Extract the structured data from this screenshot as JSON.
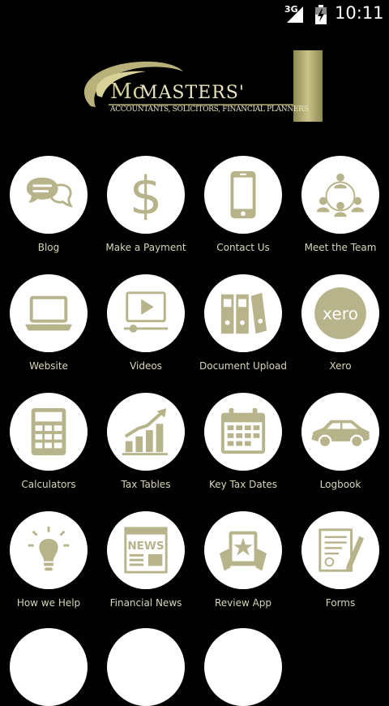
{
  "status_bar": {
    "network": "3G",
    "time": "10:11"
  },
  "logo": {
    "brand_first": "Mc",
    "brand_second": "Masters'",
    "tagline": "ACCOUNTANTS, SOLICITORS, FINANCIAL PLANNERS"
  },
  "colors": {
    "background": "#000000",
    "tile": "#ffffff",
    "icon": "#b7b48c",
    "label": "#d8d6b8",
    "brand_gold": "#b8b27a"
  },
  "tiles": [
    {
      "label": "Blog",
      "icon": "chat-bubbles-icon"
    },
    {
      "label": "Make a Payment",
      "icon": "dollar-icon"
    },
    {
      "label": "Contact Us",
      "icon": "smartphone-icon"
    },
    {
      "label": "Meet the Team",
      "icon": "team-icon"
    },
    {
      "label": "Website",
      "icon": "laptop-icon"
    },
    {
      "label": "Videos",
      "icon": "video-player-icon"
    },
    {
      "label": "Document Upload",
      "icon": "binders-icon"
    },
    {
      "label": "Xero",
      "icon": "xero-icon"
    },
    {
      "label": "Calculators",
      "icon": "calculator-icon"
    },
    {
      "label": "Tax Tables",
      "icon": "bar-chart-icon"
    },
    {
      "label": "Key Tax Dates",
      "icon": "calendar-icon"
    },
    {
      "label": "Logbook",
      "icon": "car-icon"
    },
    {
      "label": "How we Help",
      "icon": "lightbulb-icon"
    },
    {
      "label": "Financial News",
      "icon": "newspaper-icon"
    },
    {
      "label": "Review App",
      "icon": "star-tablet-icon"
    },
    {
      "label": "Forms",
      "icon": "form-pen-icon"
    }
  ]
}
